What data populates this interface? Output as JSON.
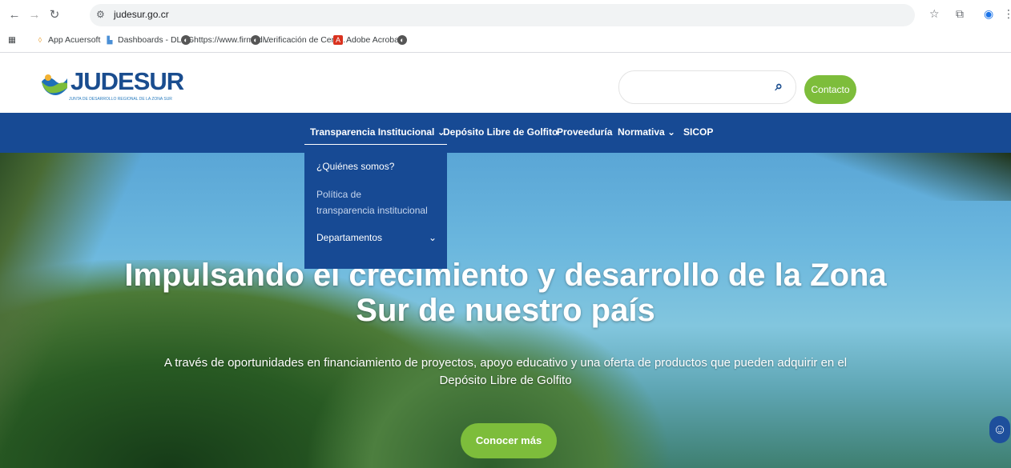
{
  "browser": {
    "url": "judesur.go.cr",
    "bookmarks": [
      "App Acuersoft",
      "Dashboards - DLCG",
      "https://www.firmadi...",
      "Verificación de Certi...",
      "Adobe Acrobat"
    ]
  },
  "header": {
    "logo_text": "JUDESUR",
    "logo_subtitle": "JUNTA DE DESARROLLO REGIONAL DE LA ZONA SUR",
    "contact_label": "Contacto"
  },
  "nav": {
    "items": [
      {
        "label": "Transparencia Institucional ⌄"
      },
      {
        "label": "Depósito Libre de Golfito"
      },
      {
        "label": "Proveeduría"
      },
      {
        "label": "Normativa ⌄"
      },
      {
        "label": "SICOP"
      }
    ]
  },
  "dropdown": {
    "items": [
      {
        "label": "¿Quiénes somos?"
      },
      {
        "label_line1": "Política de",
        "label_line2": "transparencia institucional"
      },
      {
        "label": "Departamentos",
        "chevron": "⌄"
      }
    ]
  },
  "hero": {
    "title_line1": "Impulsando el crecimiento y desarrollo de la Zona",
    "title_line2": "Sur de nuestro país",
    "subtitle_line1": "A través de oportunidades en financiamiento de proyectos, apoyo educativo y una oferta de productos que pueden adquirir en el",
    "subtitle_line2": "Depósito Libre de Golfito",
    "cta_label": "Conocer más"
  },
  "colors": {
    "brand_blue": "#174a94",
    "accent_green": "#7dbd3b"
  },
  "icons": {
    "back": "arrow-left-icon",
    "forward": "arrow-right-icon",
    "reload": "reload-icon",
    "site_info": "site-info-icon",
    "star": "star-icon",
    "extensions": "puzzle-icon",
    "profile": "profile-icon",
    "menu": "kebab-menu-icon",
    "search": "search-icon",
    "accessibility": "accessibility-icon"
  }
}
